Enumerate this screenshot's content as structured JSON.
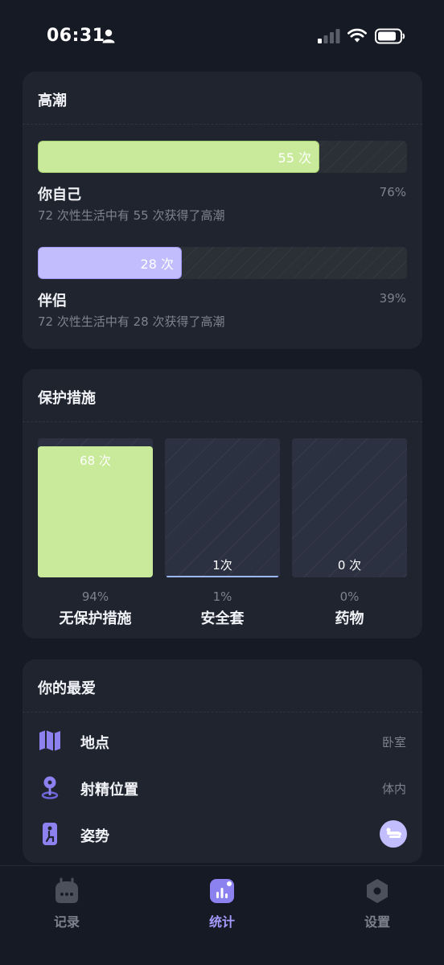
{
  "status_bar": {
    "time": "06:31"
  },
  "orgasm": {
    "title": "高潮",
    "items": [
      {
        "name": "你自己",
        "count_label": "55 次",
        "percent": "76%",
        "description": "72 次性生活中有 55 次获得了高潮",
        "fill_fraction": 0.76,
        "color": "#c8ea9a"
      },
      {
        "name": "伴侣",
        "count_label": "28 次",
        "percent": "39%",
        "description": "72 次性生活中有 28 次获得了高潮",
        "fill_fraction": 0.39,
        "color": "#c2bdfc"
      }
    ]
  },
  "protection": {
    "title": "保护措施",
    "items": [
      {
        "name": "无保护措施",
        "count_label": "68 次",
        "percent": "94%",
        "fill_fraction": 0.94
      },
      {
        "name": "安全套",
        "count_label": "1次",
        "percent": "1%",
        "fill_fraction": 0.01
      },
      {
        "name": "药物",
        "count_label": "0 次",
        "percent": "0%",
        "fill_fraction": 0
      }
    ]
  },
  "favorites": {
    "title": "你的最爱",
    "items": [
      {
        "label": "地点",
        "value": "卧室",
        "icon": "map-icon"
      },
      {
        "label": "射精位置",
        "value": "体内",
        "icon": "location-pin-icon"
      },
      {
        "label": "姿势",
        "value": "",
        "icon": "position-avatar-icon"
      }
    ]
  },
  "tabs": [
    {
      "label": "记录",
      "icon": "calendar-dots-icon",
      "active": false
    },
    {
      "label": "统计",
      "icon": "stats-chart-icon",
      "active": true
    },
    {
      "label": "设置",
      "icon": "settings-hexagon-icon",
      "active": false
    }
  ],
  "colors": {
    "background": "#161a24",
    "card": "#20242f",
    "accent": "#a59cff",
    "green": "#c8ea9a",
    "purple": "#c2bdfc"
  }
}
